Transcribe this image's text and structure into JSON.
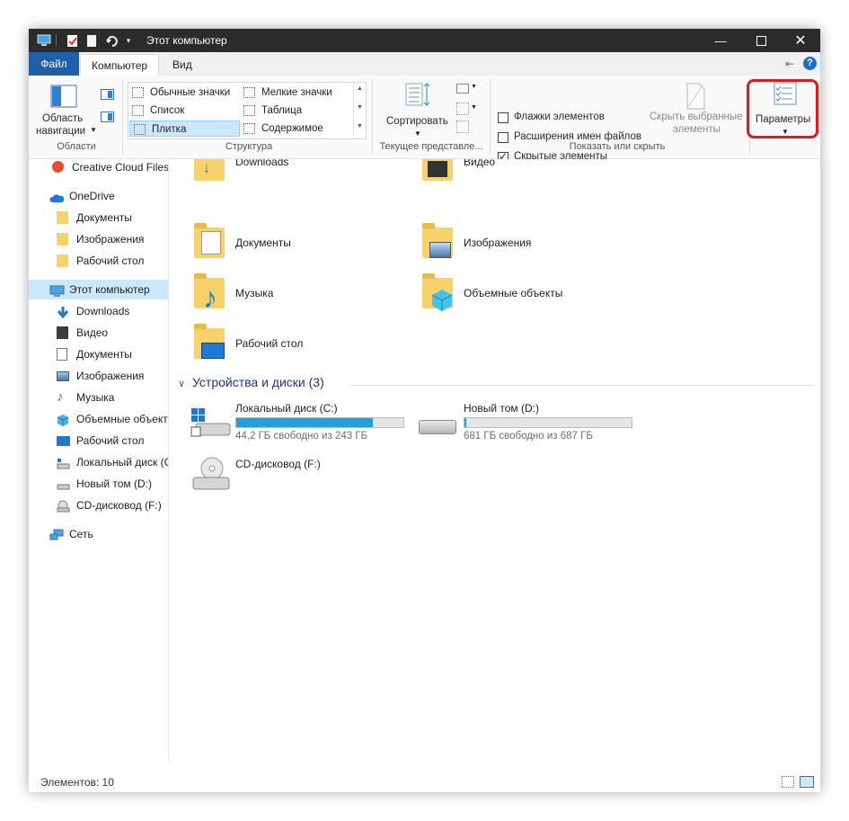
{
  "window": {
    "title": "Этот компьютер"
  },
  "tabs": [
    {
      "label": "Файл"
    },
    {
      "label": "Компьютер"
    },
    {
      "label": "Вид"
    }
  ],
  "ribbon": {
    "areas": {
      "nav_pane_line1": "Область",
      "nav_pane_line2": "навигации",
      "group_label": "Области"
    },
    "layout": {
      "items": [
        {
          "label": "Обычные значки"
        },
        {
          "label": "Мелкие значки"
        },
        {
          "label": "Список"
        },
        {
          "label": "Таблица"
        },
        {
          "label": "Плитка"
        },
        {
          "label": "Содержимое"
        }
      ],
      "selected": "Плитка",
      "group_label": "Структура"
    },
    "current_view": {
      "sort_label": "Сортировать",
      "group_label": "Текущее представле..."
    },
    "show_hide": {
      "checkboxes": [
        {
          "label": "Флажки элементов",
          "checked": false
        },
        {
          "label": "Расширения имен файлов",
          "checked": false
        },
        {
          "label": "Скрытые элементы",
          "checked": true
        }
      ],
      "hide_selected_line1": "Скрыть выбранные",
      "hide_selected_line2": "элементы",
      "group_label": "Показать или скрыть"
    },
    "options": {
      "label": "Параметры",
      "highlight_color": "#e01a1a"
    }
  },
  "nav": {
    "items": [
      {
        "label": "Creative Cloud Files",
        "icon": "creative-cloud-icon"
      },
      {
        "label": "OneDrive",
        "icon": "cloud-icon"
      },
      {
        "label": "Документы",
        "icon": "folder-icon"
      },
      {
        "label": "Изображения",
        "icon": "folder-icon"
      },
      {
        "label": "Рабочий стол",
        "icon": "folder-icon"
      },
      {
        "label": "Этот компьютер",
        "icon": "computer-icon"
      },
      {
        "label": "Downloads",
        "icon": "download-icon"
      },
      {
        "label": "Видео",
        "icon": "video-icon"
      },
      {
        "label": "Документы",
        "icon": "document-icon"
      },
      {
        "label": "Изображения",
        "icon": "image-icon"
      },
      {
        "label": "Музыка",
        "icon": "music-icon"
      },
      {
        "label": "Объемные объект",
        "icon": "cube-icon"
      },
      {
        "label": "Рабочий стол",
        "icon": "desktop-icon"
      },
      {
        "label": "Локальный диск (С",
        "icon": "drive-c-icon"
      },
      {
        "label": "Новый том (D:)",
        "icon": "drive-icon"
      },
      {
        "label": "CD-дисковод (F:)",
        "icon": "cd-icon"
      },
      {
        "label": "Сеть",
        "icon": "network-icon"
      }
    ]
  },
  "content": {
    "folders": [
      {
        "label": "Downloads",
        "icon": "download-icon"
      },
      {
        "label": "Видео",
        "icon": "video-icon"
      },
      {
        "label": "Документы",
        "icon": "document-icon"
      },
      {
        "label": "Изображения",
        "icon": "image-icon"
      },
      {
        "label": "Музыка",
        "icon": "music-icon"
      },
      {
        "label": "Объемные объекты",
        "icon": "cube-icon"
      },
      {
        "label": "Рабочий стол",
        "icon": "desktop-icon"
      }
    ],
    "devices_header": "Устройства и диски (3)",
    "drives": [
      {
        "name": "Локальный диск (C:)",
        "free": "44,2 ГБ свободно из 243 ГБ",
        "used_fraction": 0.818
      },
      {
        "name": "Новый том (D:)",
        "free": "681 ГБ свободно из 687 ГБ",
        "used_fraction": 0.009
      },
      {
        "name": "CD-дисковод (F:)",
        "free": "",
        "used_fraction": null
      }
    ]
  },
  "status": {
    "items_count": "Элементов: 10"
  },
  "colors": {
    "accent": "#1f5fa8",
    "selection": "#cce8ff",
    "bar_fill": "#26a0da",
    "folder": "#f7d26b"
  }
}
